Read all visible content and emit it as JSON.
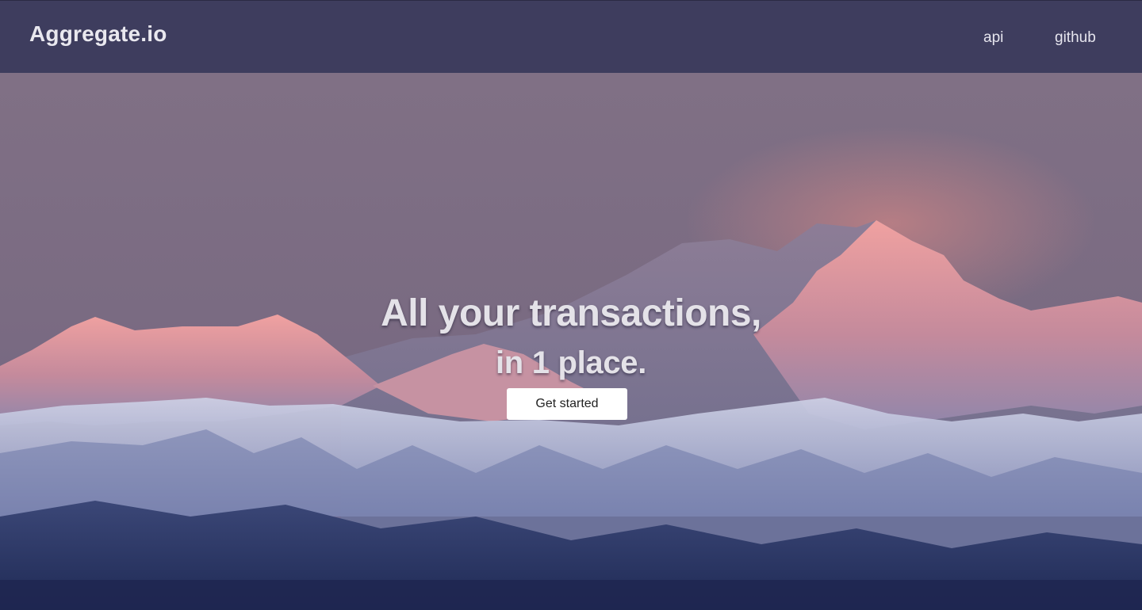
{
  "navbar": {
    "brand": "Aggregate.io",
    "links": [
      {
        "label": "api"
      },
      {
        "label": "github"
      }
    ]
  },
  "hero": {
    "headline_line1": "All your transactions,",
    "headline_line2": "in 1 place.",
    "cta_label": "Get started",
    "background_image": "snow-capped-mountain-range-at-dusk"
  },
  "colors": {
    "navbar": "#3e3d5e",
    "sky": "#7b6e86",
    "alpenglow": "#e48a8c",
    "snow": "#c9cde3",
    "foothills": "#27315c",
    "cta_background": "#ffffff"
  }
}
